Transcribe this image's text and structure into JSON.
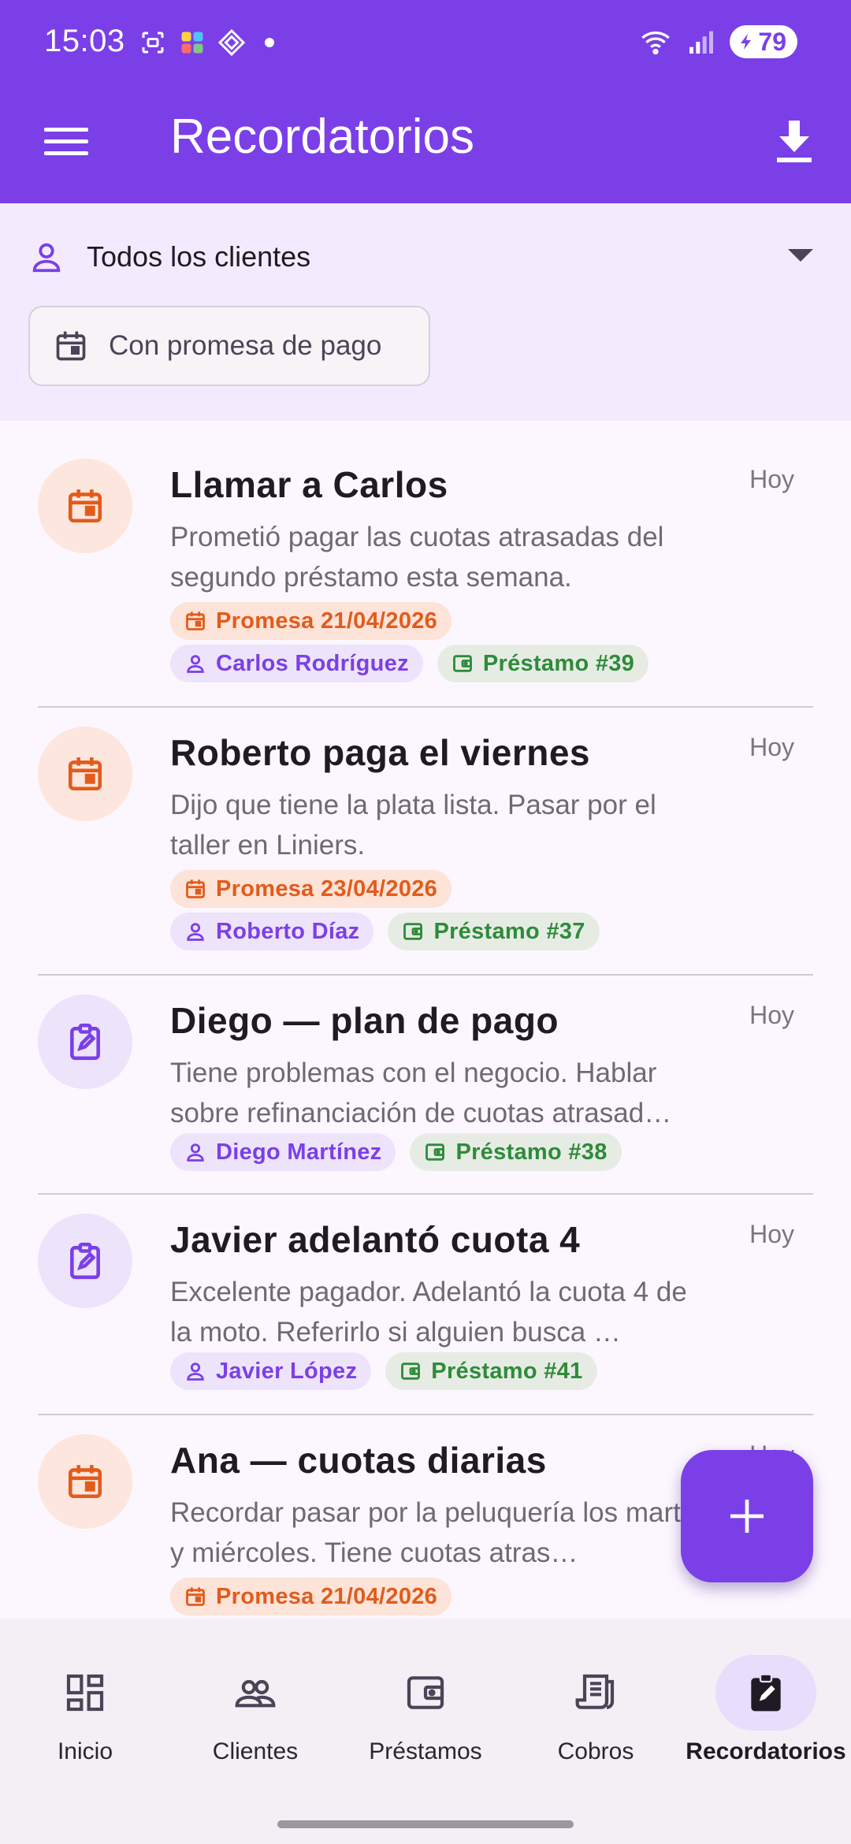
{
  "status": {
    "time": "15:03",
    "battery": "79"
  },
  "appbar": {
    "title": "Recordatorios"
  },
  "filters": {
    "client_select": "Todos los clientes",
    "promise_chip": "Con promesa de pago"
  },
  "reminders": [
    {
      "title": "Llamar a Carlos",
      "date": "Hoy",
      "description": "Prometió pagar las cuotas atrasadas del segundo préstamo esta semana.",
      "promise": "Promesa 21/04/2026",
      "client": "Carlos Rodríguez",
      "loan": "Préstamo #39",
      "icon": "calendar-icon"
    },
    {
      "title": "Roberto paga el viernes",
      "date": "Hoy",
      "description": "Dijo que tiene la plata lista. Pasar por el taller en Liniers.",
      "promise": "Promesa 23/04/2026",
      "client": "Roberto Díaz",
      "loan": "Préstamo #37",
      "icon": "calendar-icon"
    },
    {
      "title": "Diego — plan de pago",
      "date": "Hoy",
      "description": "Tiene problemas con el negocio. Hablar sobre refinanciación de cuotas atrasad…",
      "client": "Diego Martínez",
      "loan": "Préstamo #38",
      "icon": "edit-note-icon"
    },
    {
      "title": "Javier adelantó cuota 4",
      "date": "Hoy",
      "description": "Excelente pagador. Adelantó la cuota 4 de la moto. Referirlo si alguien busca …",
      "client": "Javier López",
      "loan": "Préstamo #41",
      "icon": "edit-note-icon"
    },
    {
      "title": "Ana — cuotas diarias",
      "date": "Hoy",
      "description": "Recordar pasar por la peluquería los martes y miércoles. Tiene cuotas atras…",
      "promise": "Promesa 21/04/2026",
      "icon": "calendar-icon"
    }
  ],
  "nav": {
    "items": [
      {
        "label": "Inicio"
      },
      {
        "label": "Clientes"
      },
      {
        "label": "Préstamos"
      },
      {
        "label": "Cobros"
      },
      {
        "label": "Recordatorios"
      }
    ]
  },
  "colors": {
    "primary": "#7B3FE8",
    "promise": "#E25B1B",
    "loan": "#2E8B3A"
  }
}
